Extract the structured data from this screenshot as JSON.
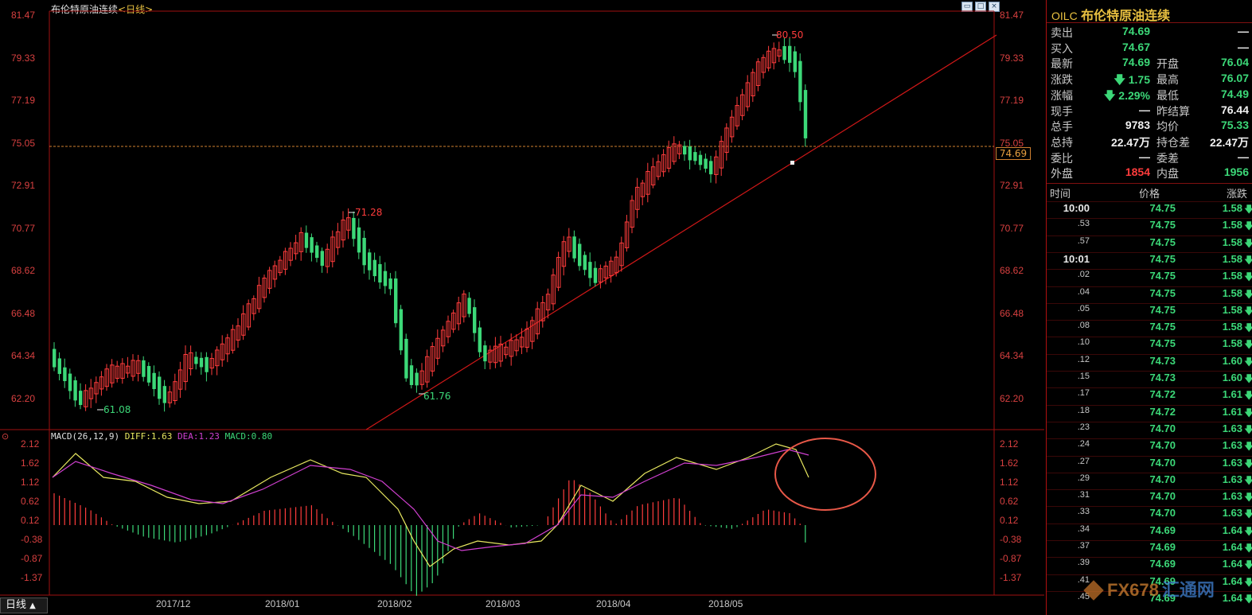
{
  "chart": {
    "title": "布伦特原油连续",
    "period_tag": "<日线>",
    "price_ticks": [
      "81.47",
      "79.33",
      "77.19",
      "75.05",
      "72.91",
      "70.77",
      "68.62",
      "66.48",
      "64.34",
      "62.20"
    ],
    "macd_ticks": [
      "2.12",
      "1.62",
      "1.12",
      "0.62",
      "0.12",
      "-0.38",
      "-0.87",
      "-1.37"
    ],
    "x_ticks": [
      "2017/12",
      "2018/01",
      "2018/02",
      "2018/03",
      "2018/04",
      "2018/05"
    ],
    "last_price_tag": "74.69",
    "annotations": {
      "high": "80.50",
      "mid_high": "71.28",
      "low1": "61.08",
      "low2": "61.76"
    },
    "macd": {
      "name": "MACD(26,12,9)",
      "diff": "DIFF:1.63",
      "dea": "DEA:1.23",
      "macd": "MACD:0.80"
    },
    "period_button": "日线",
    "window_buttons": [
      "restore",
      "max",
      "close"
    ]
  },
  "colors": {
    "up": "#ff3c3c",
    "down": "#3cd878",
    "background": "#000000",
    "axis": "#d84040",
    "diff": "#e8e860",
    "dea": "#d040d0",
    "trendline": "#d01818"
  },
  "quote": {
    "code": "OILC",
    "name": "布伦特原油连续",
    "rows": [
      {
        "l1": "卖出",
        "v1": "74.69",
        "v1c": "green",
        "l2": "",
        "v2": "—",
        "v2c": "white"
      },
      {
        "l1": "买入",
        "v1": "74.67",
        "v1c": "green",
        "l2": "",
        "v2": "—",
        "v2c": "white"
      },
      {
        "l1": "最新",
        "v1": "74.69",
        "v1c": "green",
        "l2": "开盘",
        "v2": "76.04",
        "v2c": "green"
      },
      {
        "l1": "涨跌",
        "v1": "🡇 1.75",
        "v1c": "green",
        "l2": "最高",
        "v2": "76.07",
        "v2c": "green"
      },
      {
        "l1": "涨幅",
        "v1": "🡇 2.29%",
        "v1c": "green",
        "l2": "最低",
        "v2": "74.49",
        "v2c": "green"
      },
      {
        "l1": "现手",
        "v1": "—",
        "v1c": "white",
        "l2": "昨结算",
        "v2": "76.44",
        "v2c": "white"
      },
      {
        "l1": "总手",
        "v1": "9783",
        "v1c": "white",
        "l2": "均价",
        "v2": "75.33",
        "v2c": "green"
      },
      {
        "l1": "总持",
        "v1": "22.47万",
        "v1c": "white",
        "l2": "持仓差",
        "v2": "22.47万",
        "v2c": "white"
      },
      {
        "l1": "委比",
        "v1": "—",
        "v1c": "white",
        "l2": "委差",
        "v2": "—",
        "v2c": "white"
      },
      {
        "l1": "外盘",
        "v1": "1854",
        "v1c": "red",
        "l2": "内盘",
        "v2": "1956",
        "v2c": "green"
      }
    ],
    "ticks_header": {
      "time": "时间",
      "price": "价格",
      "change": "涨跌"
    },
    "ticks": [
      {
        "time": "10:00",
        "price": "74.75",
        "change": "1.58",
        "big": true
      },
      {
        "time": ".53",
        "price": "74.75",
        "change": "1.58",
        "big": false
      },
      {
        "time": ".57",
        "price": "74.75",
        "change": "1.58",
        "big": false
      },
      {
        "time": "10:01",
        "price": "74.75",
        "change": "1.58",
        "big": true
      },
      {
        "time": ".02",
        "price": "74.75",
        "change": "1.58",
        "big": false
      },
      {
        "time": ".04",
        "price": "74.75",
        "change": "1.58",
        "big": false
      },
      {
        "time": ".05",
        "price": "74.75",
        "change": "1.58",
        "big": false
      },
      {
        "time": ".08",
        "price": "74.75",
        "change": "1.58",
        "big": false
      },
      {
        "time": ".10",
        "price": "74.75",
        "change": "1.58",
        "big": false
      },
      {
        "time": ".12",
        "price": "74.73",
        "change": "1.60",
        "big": false
      },
      {
        "time": ".15",
        "price": "74.73",
        "change": "1.60",
        "big": false
      },
      {
        "time": ".17",
        "price": "74.72",
        "change": "1.61",
        "big": false
      },
      {
        "time": ".18",
        "price": "74.72",
        "change": "1.61",
        "big": false
      },
      {
        "time": ".23",
        "price": "74.70",
        "change": "1.63",
        "big": false
      },
      {
        "time": ".24",
        "price": "74.70",
        "change": "1.63",
        "big": false
      },
      {
        "time": ".27",
        "price": "74.70",
        "change": "1.63",
        "big": false
      },
      {
        "time": ".29",
        "price": "74.70",
        "change": "1.63",
        "big": false
      },
      {
        "time": ".31",
        "price": "74.70",
        "change": "1.63",
        "big": false
      },
      {
        "time": ".33",
        "price": "74.70",
        "change": "1.63",
        "big": false
      },
      {
        "time": ".34",
        "price": "74.69",
        "change": "1.64",
        "big": false
      },
      {
        "time": ".37",
        "price": "74.69",
        "change": "1.64",
        "big": false
      },
      {
        "time": ".39",
        "price": "74.69",
        "change": "1.64",
        "big": false
      },
      {
        "time": ".41",
        "price": "74.69",
        "change": "1.64",
        "big": false
      },
      {
        "time": ".45",
        "price": "74.69",
        "change": "1.64",
        "big": false
      }
    ],
    "arrow": "🡇"
  },
  "watermark": {
    "brand": "FX678",
    "cn": "汇通网"
  }
}
